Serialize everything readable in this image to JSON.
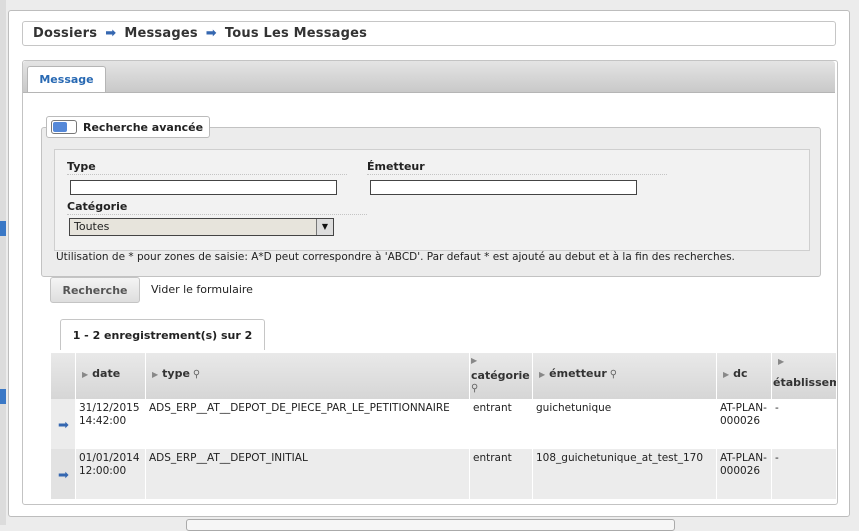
{
  "breadcrumb": {
    "items": [
      "Dossiers",
      "Messages",
      "Tous Les Messages"
    ],
    "separator_icon": "arrow-right-icon"
  },
  "tabs": [
    {
      "label": "Message",
      "active": true
    }
  ],
  "search": {
    "toggle_label": "Recherche avancée",
    "fields": {
      "type_label": "Type",
      "type_value": "",
      "emetteur_label": "Émetteur",
      "emetteur_value": "",
      "categorie_label": "Catégorie",
      "categorie_selected": "Toutes"
    },
    "hint": "Utilisation de * pour zones de saisie: A*D peut correspondre à 'ABCD'. Par defaut * est ajouté au debut et à la fin des recherches.",
    "submit_label": "Recherche",
    "reset_label": "Vider le formulaire"
  },
  "results": {
    "count_label": "1 - 2 enregistrement(s) sur 2",
    "columns": [
      {
        "key": "date",
        "label": "date"
      },
      {
        "key": "type",
        "label": "type"
      },
      {
        "key": "categorie",
        "label": "catégorie"
      },
      {
        "key": "emetteur",
        "label": "émetteur"
      },
      {
        "key": "dc",
        "label": "dc"
      },
      {
        "key": "etablissement",
        "label": "établissement"
      }
    ],
    "rows": [
      {
        "date_line1": "31/12/2015",
        "date_line2": "14:42:00",
        "type": "ADS_ERP__AT__DEPOT_DE_PIECE_PAR_LE_PETITIONNAIRE",
        "categorie": "entrant",
        "emetteur": "guichetunique",
        "dc_line1": "AT-PLAN-",
        "dc_line2": "000026",
        "etablissement": "-"
      },
      {
        "date_line1": "01/01/2014",
        "date_line2": "12:00:00",
        "type": "ADS_ERP__AT__DEPOT_INITIAL",
        "categorie": "entrant",
        "emetteur": "108_guichetunique_at_test_170",
        "dc_line1": "AT-PLAN-",
        "dc_line2": "000026",
        "etablissement": "-"
      }
    ]
  },
  "colors": {
    "accent": "#3567b0",
    "tab_text": "#2869b3",
    "toggle_on": "#5588d8"
  }
}
